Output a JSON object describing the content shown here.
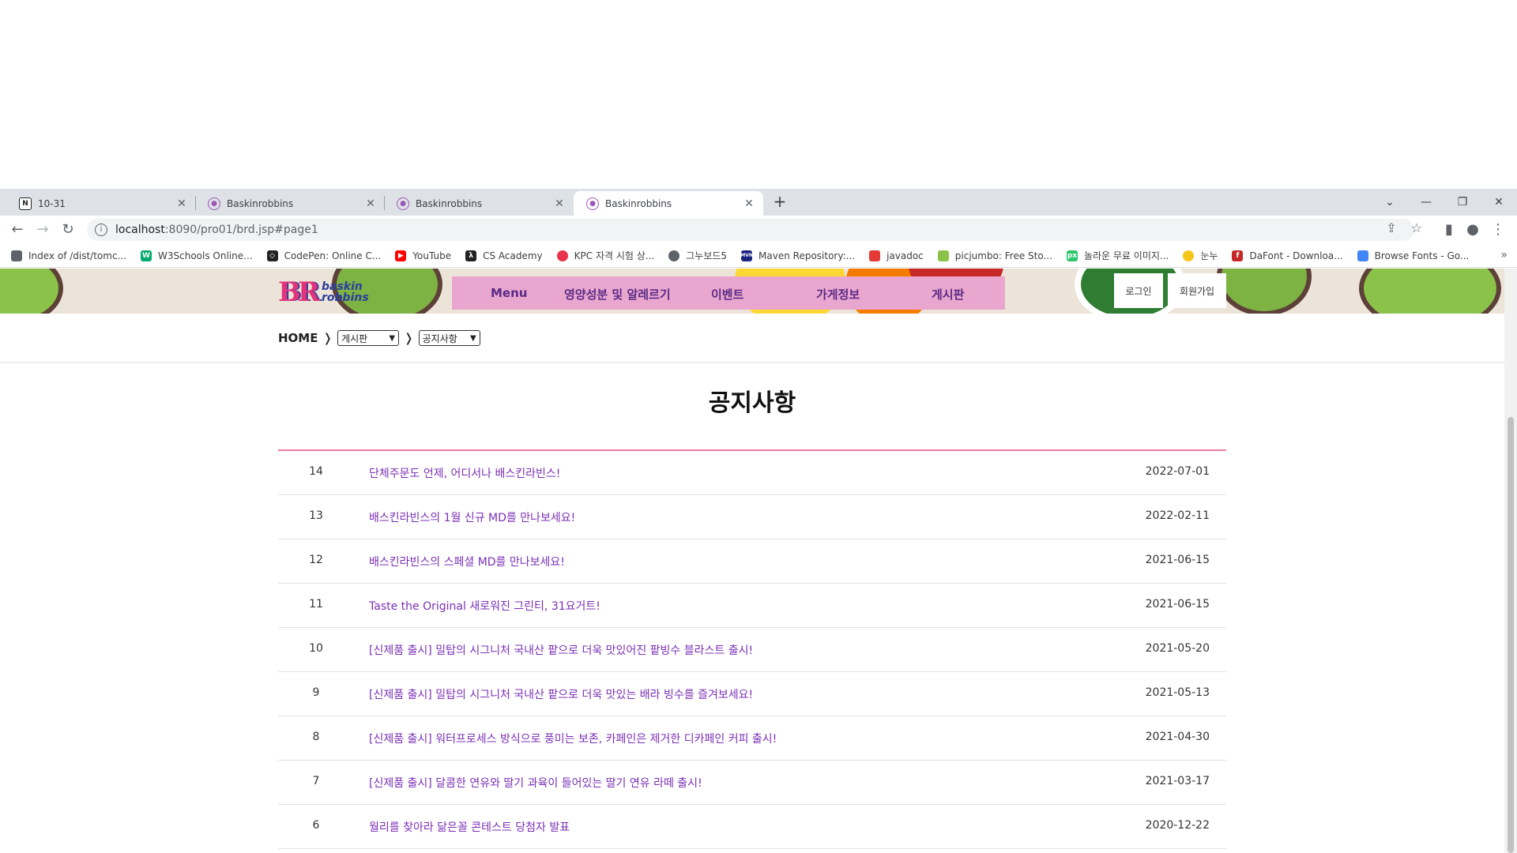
{
  "browser": {
    "tabs": [
      {
        "title": "10-31",
        "favicon": "notion-icon",
        "active": false
      },
      {
        "title": "Baskinrobbins",
        "favicon": "br-icon",
        "active": false
      },
      {
        "title": "Baskinrobbins",
        "favicon": "br-icon",
        "active": false
      },
      {
        "title": "Baskinrobbins",
        "favicon": "br-icon",
        "active": true
      }
    ],
    "url_host": "localhost",
    "url_rest": ":8090/pro01/brd.jsp#page1",
    "bookmarks": [
      {
        "label": "Index of /dist/tomc...",
        "icon": "globe-icon",
        "color": "#5f6368"
      },
      {
        "label": "W3Schools Online...",
        "icon": "w3schools-icon",
        "color": "#04aa6d"
      },
      {
        "label": "CodePen: Online C...",
        "icon": "codepen-icon",
        "color": "#222222"
      },
      {
        "label": "YouTube",
        "icon": "youtube-icon",
        "color": "#ff0000"
      },
      {
        "label": "CS Academy",
        "icon": "cs-academy-icon",
        "color": "#222222"
      },
      {
        "label": "KPC 자격 시험 상...",
        "icon": "kpc-icon",
        "color": "#e8334a"
      },
      {
        "label": "그누보드5",
        "icon": "globe-icon",
        "color": "#5f6368"
      },
      {
        "label": "Maven Repository:...",
        "icon": "maven-icon",
        "color": "#1a237e"
      },
      {
        "label": "javadoc",
        "icon": "javadoc-icon",
        "color": "#e53935"
      },
      {
        "label": "picjumbo: Free Sto...",
        "icon": "picjumbo-icon",
        "color": "#8bc34a"
      },
      {
        "label": "놀라운 무료 이미지...",
        "icon": "pixabay-icon",
        "color": "#2ec66d"
      },
      {
        "label": "눈누",
        "icon": "noonnu-icon",
        "color": "#f5c518"
      },
      {
        "label": "DaFont - Downloa...",
        "icon": "dafont-icon",
        "color": "#c62828"
      },
      {
        "label": "Browse Fonts - Go...",
        "icon": "google-fonts-icon",
        "color": "#4285f4"
      }
    ]
  },
  "site": {
    "logo_letters": "BR",
    "logo_word1": "baskin",
    "logo_word2": "robbins",
    "nav": [
      "Menu",
      "영양성분 및 알레르기",
      "이벤트",
      "가게정보",
      "게시판"
    ],
    "login": "로그인",
    "signup": "회원가입",
    "breadcrumb_home": "HOME",
    "select1": "게시판",
    "select2": "공지사항",
    "page_title": "공지사항",
    "accent_color": "#f07a9e",
    "link_color": "#7b2fb5"
  },
  "notices": [
    {
      "num": "14",
      "subject": "단체주문도 언제, 어디서나 배스킨라빈스!",
      "date": "2022-07-01"
    },
    {
      "num": "13",
      "subject": "배스킨라빈스의 1월 신규 MD를 만나보세요!",
      "date": "2022-02-11"
    },
    {
      "num": "12",
      "subject": "배스킨라빈스의 스페셜 MD를 만나보세요!",
      "date": "2021-06-15"
    },
    {
      "num": "11",
      "subject": "Taste the Original 새로워진 그린티, 31요거트!",
      "date": "2021-06-15"
    },
    {
      "num": "10",
      "subject": "[신제품 출시] 밀탑의 시그니처 국내산 팥으로 더욱 맛있어진 팥빙수 블라스트 출시!",
      "date": "2021-05-20"
    },
    {
      "num": "9",
      "subject": "[신제품 출시] 밀탑의 시그니처 국내산 팥으로 더욱 맛있는 배라 빙수를 즐겨보세요!",
      "date": "2021-05-13"
    },
    {
      "num": "8",
      "subject": "[신제품 출시] 워터프로세스 방식으로 풍미는 보존, 카페인은 제거한 디카페인 커피 출시!",
      "date": "2021-04-30"
    },
    {
      "num": "7",
      "subject": "[신제품 출시] 달콤한 연유와 딸기 과육이 들어있는 딸기 연유 라떼 출시!",
      "date": "2021-03-17"
    },
    {
      "num": "6",
      "subject": "월리를 찾아라 닮은꼴 콘테스트 당첨자 발표",
      "date": "2020-12-22"
    }
  ]
}
